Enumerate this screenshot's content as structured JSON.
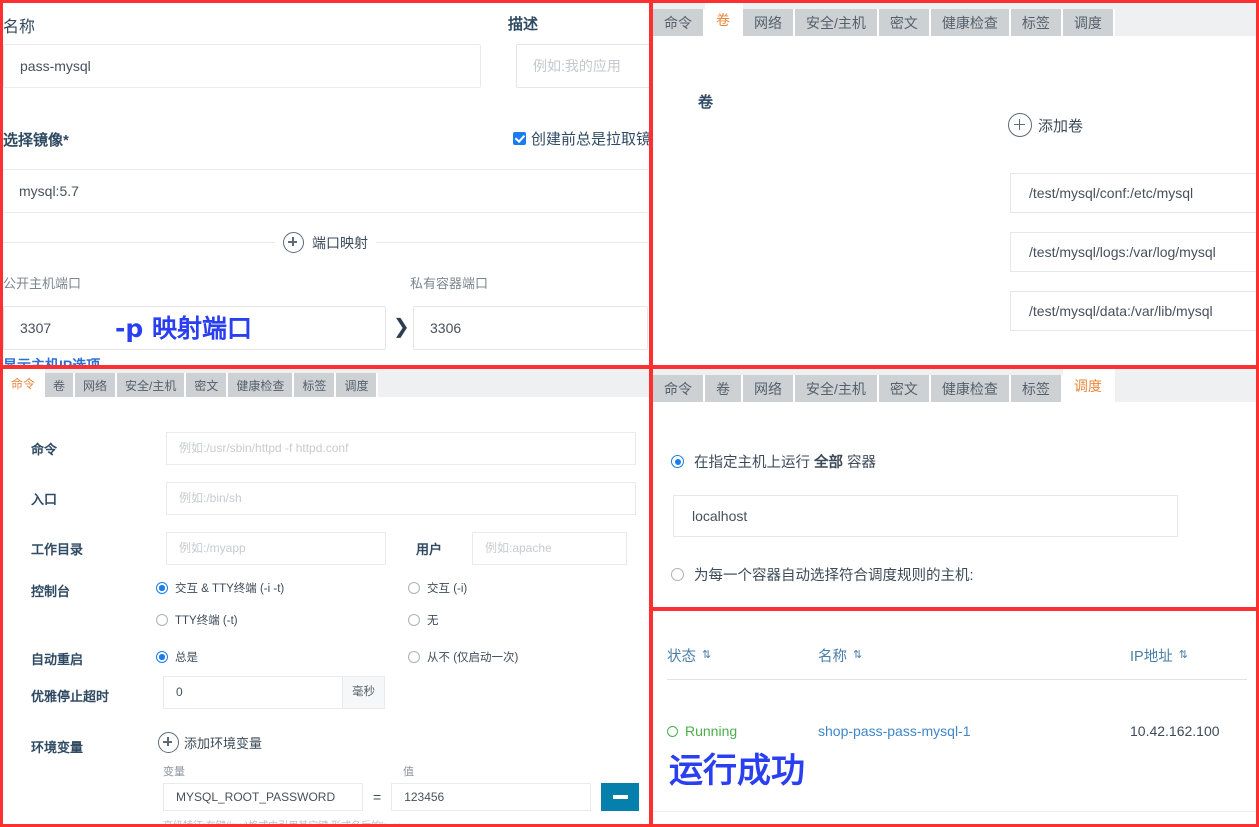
{
  "panel_a": {
    "name_label": "名称",
    "name_value": "pass-mysql",
    "desc_label": "描述",
    "desc_placeholder": "例如:我的应用",
    "image_label": "选择镜像*",
    "pull_checkbox_label": "创建前总是拉取镜像",
    "image_value": "mysql:5.7",
    "port_section_label": "端口映射",
    "host_port_label": "公开主机端口",
    "container_port_label": "私有容器端口",
    "host_port_value": "3307",
    "container_port_value": "3306",
    "annotation": "-p 映射端口",
    "host_ip_link": "显示主机IP选项"
  },
  "tabs": [
    "命令",
    "卷",
    "网络",
    "安全/主机",
    "密文",
    "健康检查",
    "标签",
    "调度"
  ],
  "panel_b": {
    "active_tab": "卷",
    "title": "卷",
    "add_button": "添加卷",
    "volumes": [
      "/test/mysql/conf:/etc/mysql",
      "/test/mysql/logs:/var/log/mysql",
      "/test/mysql/data:/var/lib/mysql"
    ]
  },
  "panel_c": {
    "active_tab": "命令",
    "command_label": "命令",
    "command_placeholder": "例如:/usr/sbin/httpd -f httpd.conf",
    "entry_label": "入口",
    "entry_placeholder": "例如:/bin/sh",
    "workdir_label": "工作目录",
    "workdir_placeholder": "例如:/myapp",
    "user_label": "用户",
    "user_placeholder": "例如:apache",
    "console_label": "控制台",
    "console_options": [
      {
        "label": "交互 & TTY终端 (-i -t)",
        "selected": true
      },
      {
        "label": "交互 (-i)",
        "selected": false
      },
      {
        "label": "TTY终端 (-t)",
        "selected": false
      },
      {
        "label": "无",
        "selected": false
      }
    ],
    "restart_label": "自动重启",
    "restart_options": [
      {
        "label": "总是",
        "selected": true
      },
      {
        "label": "从不 (仅启动一次)",
        "selected": false
      }
    ],
    "stop_timeout_label": "优雅停止超时",
    "stop_timeout_value": "0",
    "stop_timeout_unit": "毫秒",
    "env_label": "环境变量",
    "env_add_button": "添加环境变量",
    "env_col_key": "变量",
    "env_col_value": "值",
    "env_rows": [
      {
        "key": "MYSQL_ROOT_PASSWORD",
        "eq": "=",
        "value": "123456"
      }
    ],
    "env_hint": "高级特征:在键(k=v)格式中引用其它键,形式名后的k...v..."
  },
  "panel_d": {
    "active_tab": "调度",
    "option_specific_prefix": "在指定主机上运行 ",
    "option_specific_strong": "全部",
    "option_specific_suffix": " 容器",
    "host_value": "localhost",
    "option_auto": "为每一个容器自动选择符合调度规则的主机:"
  },
  "panel_e": {
    "columns": [
      "状态",
      "名称",
      "IP地址"
    ],
    "sort_icon": "⇅",
    "rows": [
      {
        "status": "Running",
        "name": "shop-pass-pass-mysql-1",
        "ip": "10.42.162.100"
      }
    ],
    "annotation": "运行成功"
  },
  "colors": {
    "border_red": "#fc3030",
    "tab_active_text": "#e9863a",
    "annotation_blue": "#2a3ff0",
    "accent_blue": "#1b7ced",
    "minus_button": "#0580ad",
    "running_green": "#4cae4c",
    "link_blue": "#3f86c9"
  }
}
